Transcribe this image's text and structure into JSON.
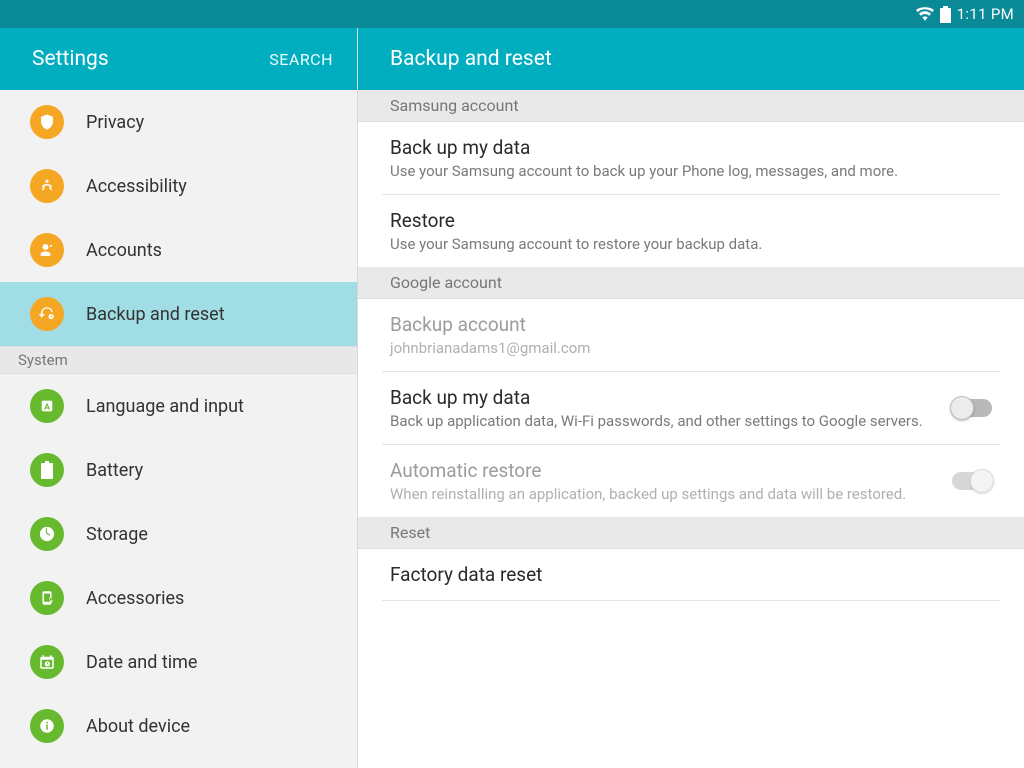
{
  "statusbar": {
    "time": "1:11 PM"
  },
  "sidebar": {
    "title": "Settings",
    "search_label": "SEARCH",
    "main_items": [
      {
        "id": "privacy",
        "label": "Privacy",
        "icon": "privacy",
        "color": "orange",
        "selected": false
      },
      {
        "id": "accessibility",
        "label": "Accessibility",
        "icon": "accessibility",
        "color": "orange",
        "selected": false
      },
      {
        "id": "accounts",
        "label": "Accounts",
        "icon": "accounts",
        "color": "orange",
        "selected": false
      },
      {
        "id": "backup",
        "label": "Backup and reset",
        "icon": "backup",
        "color": "orange",
        "selected": true
      }
    ],
    "system_section_label": "System",
    "system_items": [
      {
        "id": "language",
        "label": "Language and input",
        "icon": "language",
        "color": "green"
      },
      {
        "id": "battery",
        "label": "Battery",
        "icon": "battery",
        "color": "green"
      },
      {
        "id": "storage",
        "label": "Storage",
        "icon": "storage",
        "color": "green"
      },
      {
        "id": "accessories",
        "label": "Accessories",
        "icon": "accessories",
        "color": "green"
      },
      {
        "id": "datetime",
        "label": "Date and time",
        "icon": "datetime",
        "color": "green"
      },
      {
        "id": "about",
        "label": "About device",
        "icon": "about",
        "color": "green"
      }
    ]
  },
  "main": {
    "title": "Backup and reset",
    "sections": {
      "samsung": {
        "header": "Samsung account",
        "backup": {
          "title": "Back up my data",
          "sub": "Use your Samsung account to back up your Phone log, messages, and more."
        },
        "restore": {
          "title": "Restore",
          "sub": "Use your Samsung account to restore your backup data."
        }
      },
      "google": {
        "header": "Google account",
        "account": {
          "title": "Backup account",
          "sub": "johnbrianadams1@gmail.com",
          "disabled": true
        },
        "backup": {
          "title": "Back up my data",
          "sub": "Back up application data, Wi-Fi passwords, and other settings to Google servers.",
          "toggle": false
        },
        "autorestore": {
          "title": "Automatic restore",
          "sub": "When reinstalling an application, backed up settings and data will be restored.",
          "toggle": true,
          "disabled": true
        }
      },
      "reset": {
        "header": "Reset",
        "factory": {
          "title": "Factory data reset"
        }
      }
    }
  }
}
